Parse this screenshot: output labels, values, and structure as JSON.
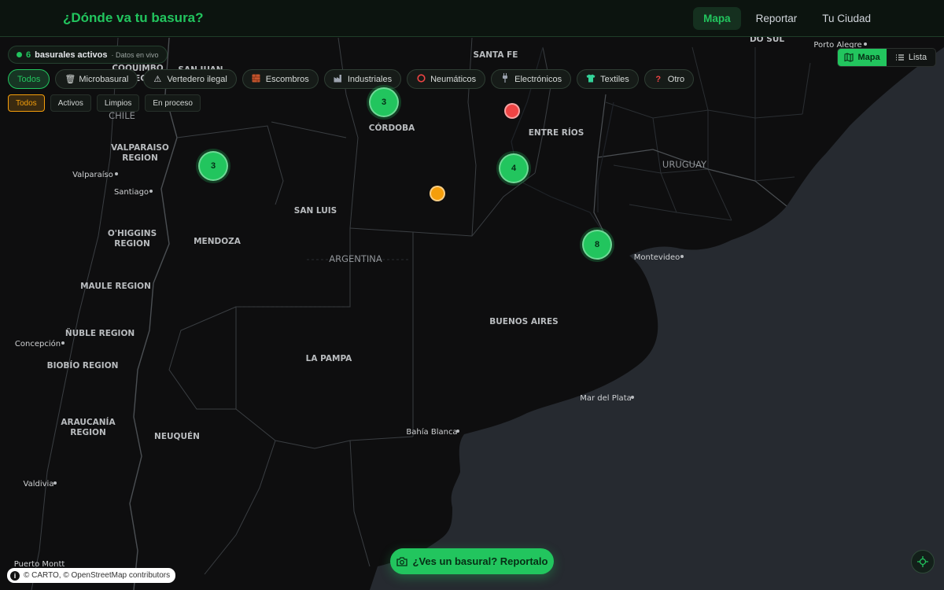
{
  "header": {
    "brand": "¿Dónde va tu basura?",
    "nav": [
      {
        "label": "Mapa",
        "active": true
      },
      {
        "label": "Reportar",
        "active": false
      },
      {
        "label": "Tu Ciudad",
        "active": false
      }
    ]
  },
  "view_toggle": {
    "map_label": "Mapa",
    "list_label": "Lista",
    "active": "Mapa"
  },
  "status": {
    "count": "6",
    "text": "basurales activos",
    "sub": "· Datos en vivo"
  },
  "categories": [
    {
      "label": "Todos",
      "icon": "",
      "active": true
    },
    {
      "label": "Microbasural",
      "icon": "trash-icon",
      "active": false
    },
    {
      "label": "Vertedero ilegal",
      "icon": "warning-icon",
      "active": false
    },
    {
      "label": "Escombros",
      "icon": "brick-icon",
      "active": false
    },
    {
      "label": "Industriales",
      "icon": "factory-icon",
      "active": false
    },
    {
      "label": "Neumáticos",
      "icon": "tire-icon",
      "active": false
    },
    {
      "label": "Electrónicos",
      "icon": "plug-icon",
      "active": false
    },
    {
      "label": "Textiles",
      "icon": "shirt-icon",
      "active": false
    },
    {
      "label": "Otro",
      "icon": "question-icon",
      "active": false
    }
  ],
  "status_filters": [
    {
      "label": "Todos",
      "active": true
    },
    {
      "label": "Activos",
      "active": false
    },
    {
      "label": "Limpios",
      "active": false
    },
    {
      "label": "En proceso",
      "active": false
    }
  ],
  "map": {
    "clusters": [
      {
        "count": "3"
      },
      {
        "count": "3"
      },
      {
        "count": "4"
      },
      {
        "count": "8"
      }
    ],
    "points": [
      {
        "status_color": "#ef4444"
      },
      {
        "status_color": "#f59e0b"
      }
    ],
    "labels": {
      "do_sul": "DO SUL",
      "porto_alegre": "Porto Alegre",
      "santa_fe": "SANTA FE",
      "coquimbo": "COQUIMBO",
      "region_trunc": "REG",
      "san_juan": "SAN JUAN",
      "cordoba": "CÓRDOBA",
      "entre_rios": "ENTRE RÍOS",
      "chile": "CHILE",
      "valparaiso_region": "VALPARAISO REGION",
      "valparaiso": "Valparaíso",
      "santiago": "Santiago",
      "uruguay": "URUGUAY",
      "san_luis": "SAN LUIS",
      "mendoza": "MENDOZA",
      "ohiggins": "O'HIGGINS REGION",
      "argentina": "ARGENTINA",
      "montevideo": "Montevideo",
      "maule": "MAULE REGION",
      "buenos_aires": "BUENOS AIRES",
      "nuble": "ÑUBLE REGION",
      "concepcion": "Concepción",
      "biobio": "BIOBÍO REGION",
      "la_pampa": "LA PAMPA",
      "mar_del_plata": "Mar del Plata",
      "araucania": "ARAUCANÍA REGION",
      "bahia_blanca": "Bahía Blanca",
      "neuquen": "NEUQUÉN",
      "valdivia": "Valdivia",
      "puerto_montt": "Puerto Montt"
    }
  },
  "cta": {
    "label": "¿Ves un basural? Reportalo"
  },
  "attribution": {
    "text": "© CARTO, © OpenStreetMap contributors"
  },
  "colors": {
    "accent": "#22c55e",
    "warning": "#f59e0b",
    "danger": "#ef4444"
  }
}
